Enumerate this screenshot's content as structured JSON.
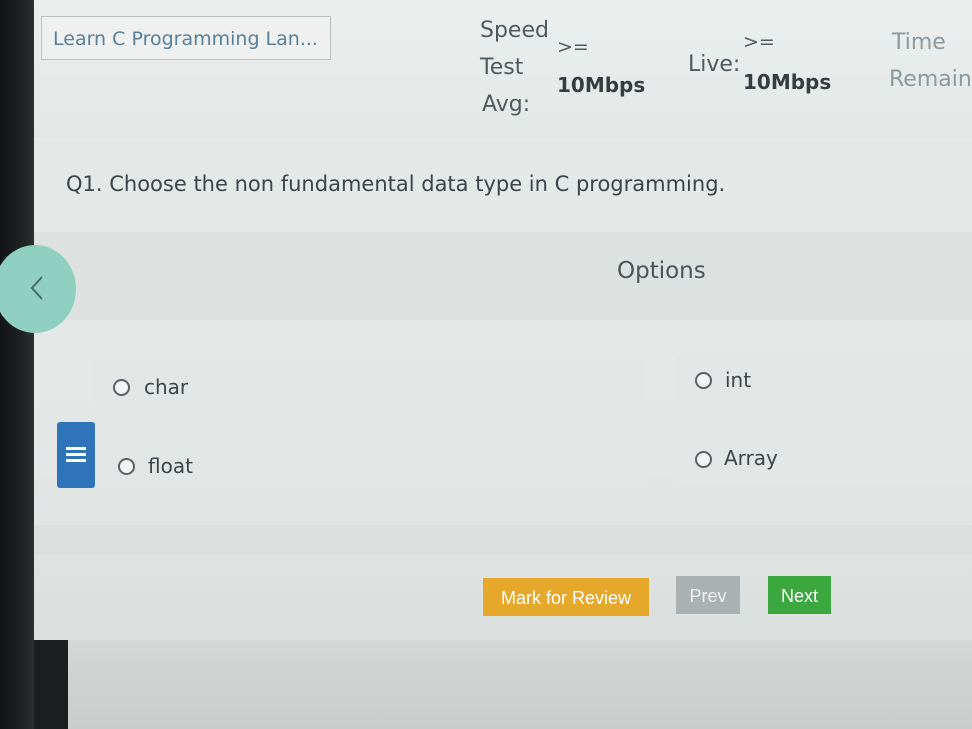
{
  "header": {
    "course_title": "Learn C Programming Lan...",
    "speed_line1": "Speed",
    "speed_line2": "Test",
    "speed_line3": "Avg:",
    "speed_cmp": ">=",
    "speed_value": "10Mbps",
    "live_label": "Live:",
    "live_cmp": ">=",
    "live_value": "10Mbps",
    "time_label": "Time",
    "remain_label": "Remain"
  },
  "question": {
    "text": "Q1. Choose the non fundamental data type in C programming."
  },
  "options": {
    "title": "Options",
    "items": [
      {
        "label": "char"
      },
      {
        "label": "int"
      },
      {
        "label": "float"
      },
      {
        "label": "Array"
      }
    ]
  },
  "buttons": {
    "mark_review": "Mark for Review",
    "prev": "Prev",
    "next": "Next"
  },
  "colors": {
    "review": "#e6a82a",
    "prev": "#a9b1b2",
    "next": "#3aa83f",
    "back": "#8fcfc0",
    "menu": "#2f74b8"
  },
  "icons": {
    "back": "chevron-left-icon",
    "menu": "hamburger-icon"
  }
}
